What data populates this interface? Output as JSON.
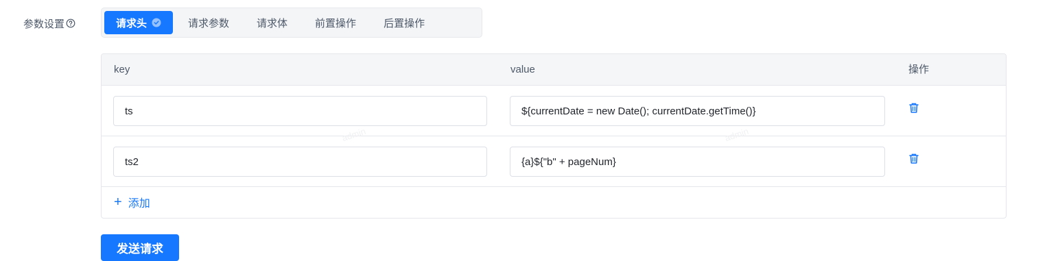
{
  "form": {
    "label": "参数设置"
  },
  "tabs": [
    {
      "label": "请求头",
      "active": true
    },
    {
      "label": "请求参数"
    },
    {
      "label": "请求体"
    },
    {
      "label": "前置操作"
    },
    {
      "label": "后置操作"
    }
  ],
  "table": {
    "columns": {
      "key": "key",
      "value": "value",
      "actions": "操作"
    },
    "rows": [
      {
        "key": "ts",
        "value": "${currentDate = new Date(); currentDate.getTime()}"
      },
      {
        "key": "ts2",
        "value": "{a}${\"b\" + pageNum}"
      }
    ],
    "add_label": "添加"
  },
  "submit_label": "发送请求",
  "watermark": "admin",
  "colors": {
    "primary": "#1677ff",
    "label": "#4e5969"
  },
  "icons": {
    "help": "question-circle-icon",
    "check": "check-circle-icon",
    "delete": "trash-icon",
    "add": "plus-icon"
  }
}
